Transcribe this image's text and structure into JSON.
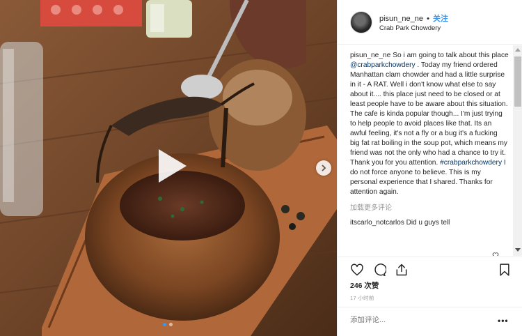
{
  "post": {
    "username": "pisun_ne_ne",
    "separator": "•",
    "follow_label": "关注",
    "location": "Crab Park Chowdery",
    "caption_user": "pisun_ne_ne",
    "caption_part1": "So i am going to talk about this place",
    "caption_tag1": "@crabparkchowdery",
    "caption_part2": ". Today my friend ordered Manhattan clam chowder and had a little surprise in it - A RAT. Well i don't know what else to say about it.... this place just need to be closed or at least people have to be aware about this situation. The cafe is kinda popular though... I'm just trying to help people to avoid places like that. Its an awful feeling, it's not a fly or a bug it's a fucking big fat rat boiling in the soup pot, which means my friend was not the only who had a chance to try it. Thank you for you attention.",
    "caption_tag2": "#crabparkchowdery",
    "caption_part3": "I do not force anyone to believe. This is my personal experience that I shared. Thanks for attention again.",
    "load_more": "加载更多评论",
    "comment_user": "itscarlo_notcarlos",
    "comment_text": "Did u guys tell",
    "likes": "246 次赞",
    "time": "17 小时前",
    "add_comment_placeholder": "添加评论...",
    "more_label": "•••"
  },
  "icons": {
    "like": "heart-icon",
    "comment": "comment-icon",
    "share": "share-icon",
    "save": "bookmark-icon",
    "play": "play-icon",
    "next": "chevron-right-icon"
  },
  "colors": {
    "link": "#003569",
    "follow": "#3897f0",
    "muted": "#999999",
    "text": "#262626"
  },
  "carousel": {
    "slides": 2,
    "active": 1
  }
}
